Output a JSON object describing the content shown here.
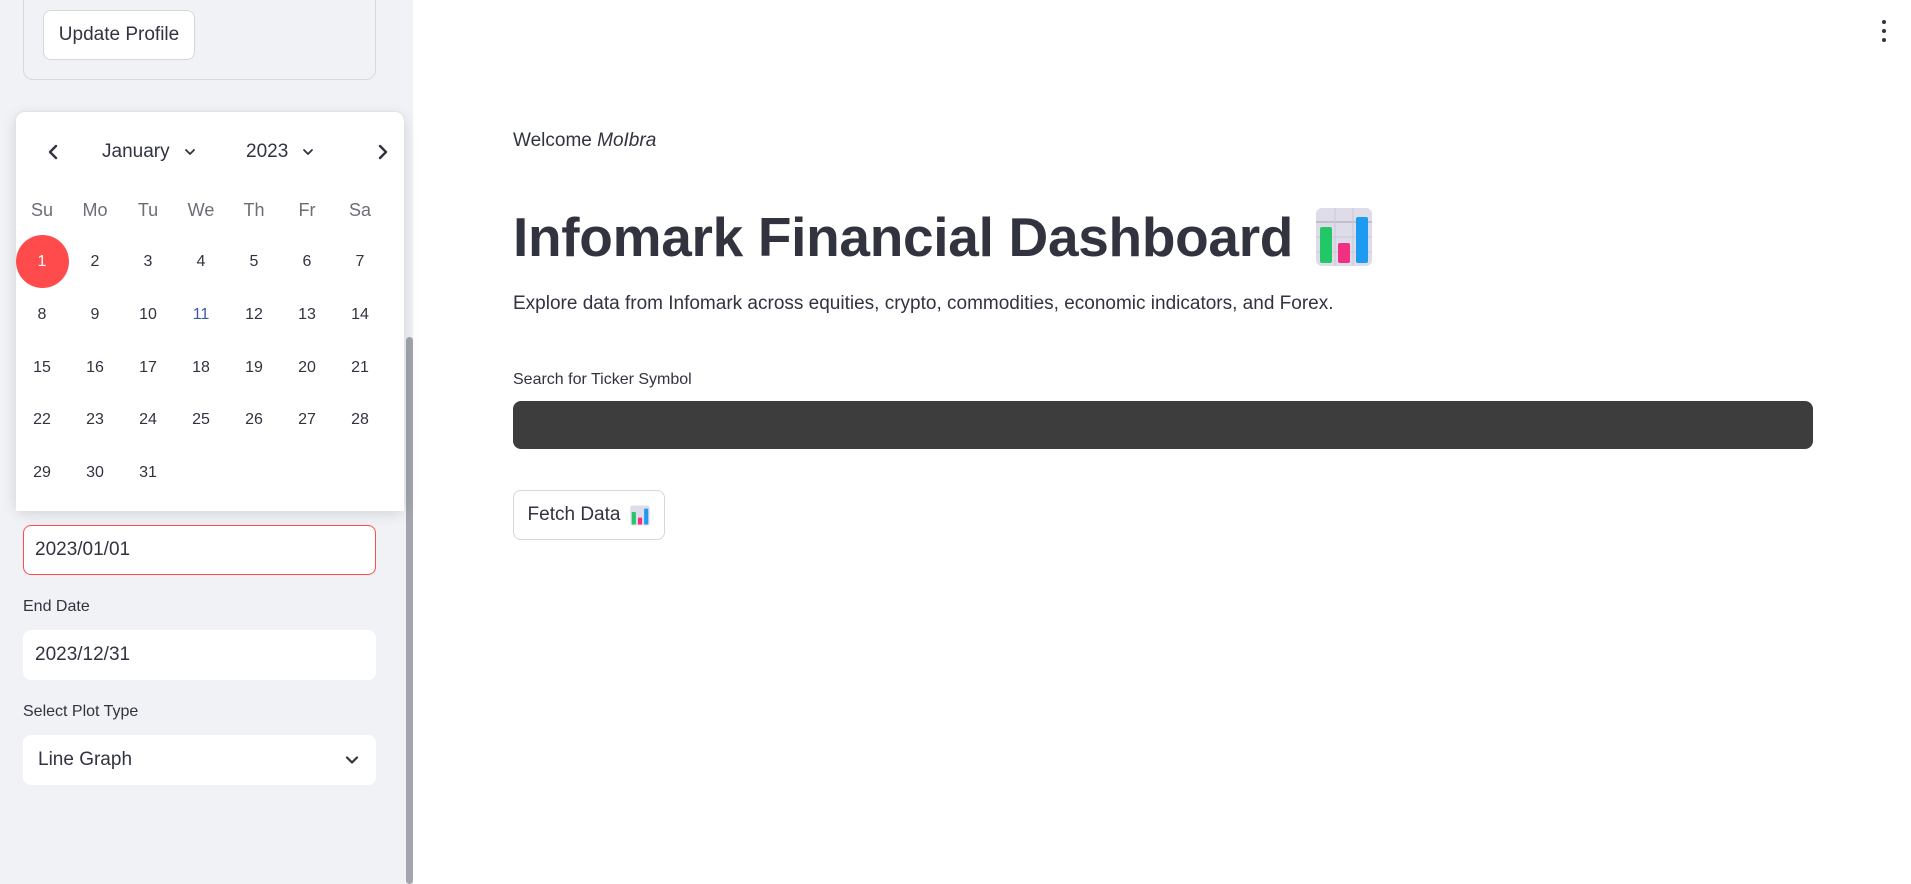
{
  "sidebar": {
    "update_profile_label": "Update Profile",
    "start_date_value": "2023/01/01",
    "end_date_label": "End Date",
    "end_date_value": "2023/12/31",
    "plot_type_label": "Select Plot Type",
    "plot_type_value": "Line Graph"
  },
  "calendar": {
    "month": "January",
    "year": "2023",
    "weekdays": [
      "Su",
      "Mo",
      "Tu",
      "We",
      "Th",
      "Fr",
      "Sa"
    ],
    "days": [
      1,
      2,
      3,
      4,
      5,
      6,
      7,
      8,
      9,
      10,
      11,
      12,
      13,
      14,
      15,
      16,
      17,
      18,
      19,
      20,
      21,
      22,
      23,
      24,
      25,
      26,
      27,
      28,
      29,
      30,
      31
    ],
    "selected_day": 1,
    "highlight_day": 11,
    "accent_color": "#ff4b4b"
  },
  "main": {
    "welcome_prefix": "Welcome ",
    "welcome_user": "MoIbra",
    "title": "Infomark Financial Dashboard",
    "title_icon": "bar-chart-icon",
    "subtitle": "Explore data from Infomark across equities, crypto, commodities, economic indicators, and Forex.",
    "search_label": "Search for Ticker Symbol",
    "search_value": "",
    "fetch_label": "Fetch Data",
    "fetch_icon": "bar-chart-icon",
    "menu_icon": "kebab-menu-icon"
  }
}
